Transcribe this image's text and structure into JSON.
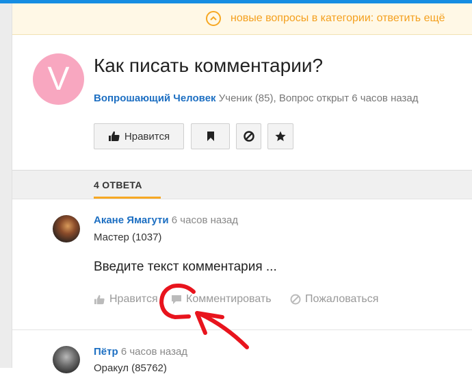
{
  "banner": {
    "text": "новые вопросы в категории: ответить ещё"
  },
  "question": {
    "avatar_letter": "V",
    "title": "Как писать комментарии?",
    "author": "Вопрошающий Человек",
    "meta": "Ученик (85), Вопрос открыт 6 часов назад"
  },
  "actions": {
    "like_label": "Нравится"
  },
  "answers": {
    "header": "4 ОТВЕТА",
    "items": [
      {
        "name": "Акане Ямагути",
        "time": "6 часов назад",
        "rank": "Мастер (1037)",
        "text": "Введите текст комментария ...",
        "like_label": "Нравится",
        "comment_label": "Комментировать",
        "report_label": "Пожаловаться"
      },
      {
        "name": "Пётр",
        "time": "6 часов назад",
        "rank": "Оракул (85762)"
      }
    ]
  },
  "colors": {
    "accent": "#f7a823",
    "link": "#1d6fc2",
    "annotation": "#e8141d",
    "topbar": "#168de2"
  }
}
